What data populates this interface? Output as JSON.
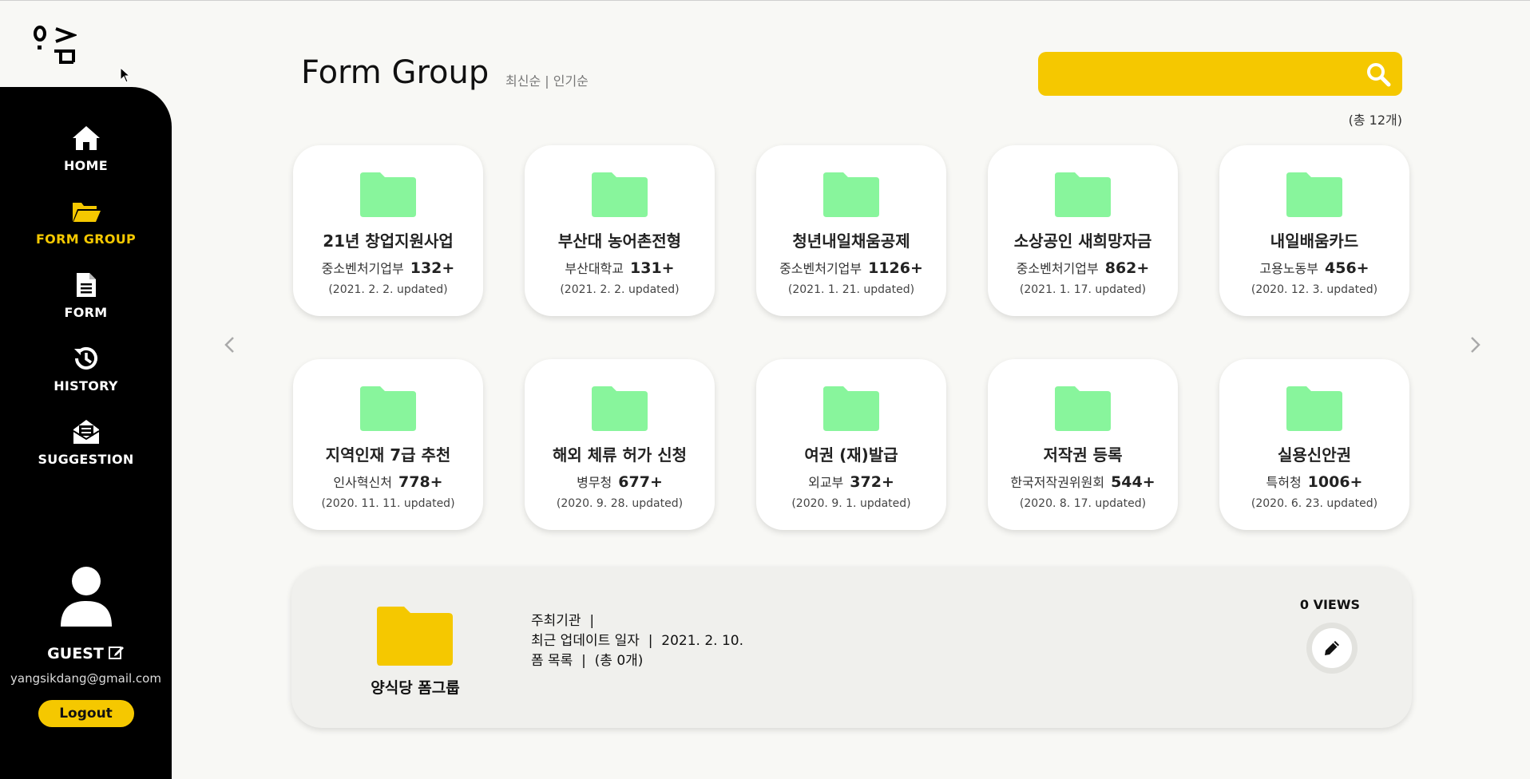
{
  "sidebar": {
    "nav": [
      {
        "label": "HOME",
        "icon": "home-icon"
      },
      {
        "label": "FORM GROUP",
        "icon": "folder-open-icon"
      },
      {
        "label": "FORM",
        "icon": "document-icon"
      },
      {
        "label": "HISTORY",
        "icon": "history-icon"
      },
      {
        "label": "SUGGESTION",
        "icon": "mail-open-icon"
      }
    ],
    "user": {
      "name": "GUEST",
      "email": "yangsikdang@gmail.com",
      "logout_label": "Logout"
    }
  },
  "header": {
    "title": "Form Group",
    "sort_latest": "최신순",
    "sort_sep": " | ",
    "sort_popular": "인기순",
    "search_placeholder": "",
    "total": "(총 12개)"
  },
  "cards": [
    {
      "title": "21년 창업지원사업",
      "org": "중소벤처기업부",
      "count": "132+",
      "date": "(2021. 2. 2. updated)"
    },
    {
      "title": "부산대 농어촌전형",
      "org": "부산대학교",
      "count": "131+",
      "date": "(2021. 2. 2. updated)"
    },
    {
      "title": "청년내일채움공제",
      "org": "중소벤처기업부",
      "count": "1126+",
      "date": "(2021. 1. 21. updated)"
    },
    {
      "title": "소상공인 새희망자금",
      "org": "중소벤처기업부",
      "count": "862+",
      "date": "(2021. 1. 17. updated)"
    },
    {
      "title": "내일배움카드",
      "org": "고용노동부",
      "count": "456+",
      "date": "(2020. 12. 3. updated)"
    },
    {
      "title": "지역인재 7급 추천",
      "org": "인사혁신처",
      "count": "778+",
      "date": "(2020. 11. 11. updated)"
    },
    {
      "title": "해외 체류 허가 신청",
      "org": "병무청",
      "count": "677+",
      "date": "(2020. 9. 28. updated)"
    },
    {
      "title": "여권 (재)발급",
      "org": "외교부",
      "count": "372+",
      "date": "(2020. 9. 1. updated)"
    },
    {
      "title": "저작권 등록",
      "org": "한국저작권위원회",
      "count": "544+",
      "date": "(2020. 8. 17. updated)"
    },
    {
      "title": "실용신안권",
      "org": "특허청",
      "count": "1006+",
      "date": "(2020. 6. 23. updated)"
    }
  ],
  "detail": {
    "name": "양식당 폼그룹",
    "host_line": "주최기관  |",
    "updated_line": "최근 업데이트 일자  |  2021. 2. 10.",
    "forms_line": "폼 목록  |  (총 0개)",
    "views": "0 VIEWS"
  },
  "colors": {
    "accent": "#f5c800",
    "folder_green": "#88f59c",
    "sidebar_bg": "#000000",
    "page_bg": "#f8f8f5"
  }
}
